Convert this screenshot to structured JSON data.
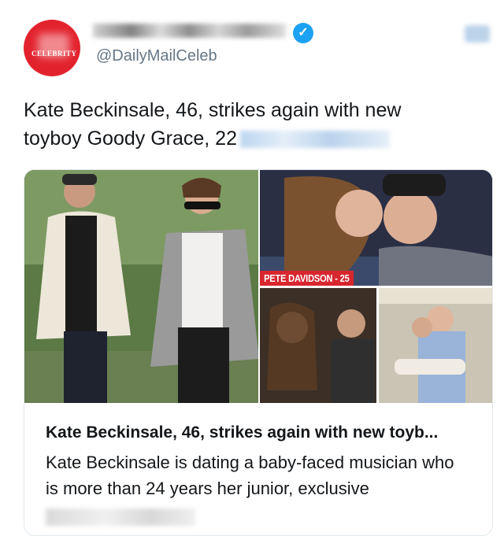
{
  "account": {
    "handle": "@DailyMailCeleb",
    "verified": true,
    "avatar_label": "CELEBRITY",
    "avatar_color": "#e2232e"
  },
  "tweet": {
    "text_line1": "Kate Beckinsale, 46, strikes again with new",
    "text_line2": "toyboy Goody Grace, 22"
  },
  "card": {
    "image_label": "PETE DAVIDSON - 25",
    "title": "Kate Beckinsale, 46, strikes again with new toyb...",
    "description": "Kate Beckinsale is dating a baby-faced musician who is more than 24 years her junior, exclusive"
  },
  "colors": {
    "verified_blue": "#1da1f2",
    "handle_gray": "#657786",
    "label_red": "#d8262f"
  },
  "icons": {
    "verified": "verified-badge-icon",
    "menu": "more-menu-icon"
  }
}
